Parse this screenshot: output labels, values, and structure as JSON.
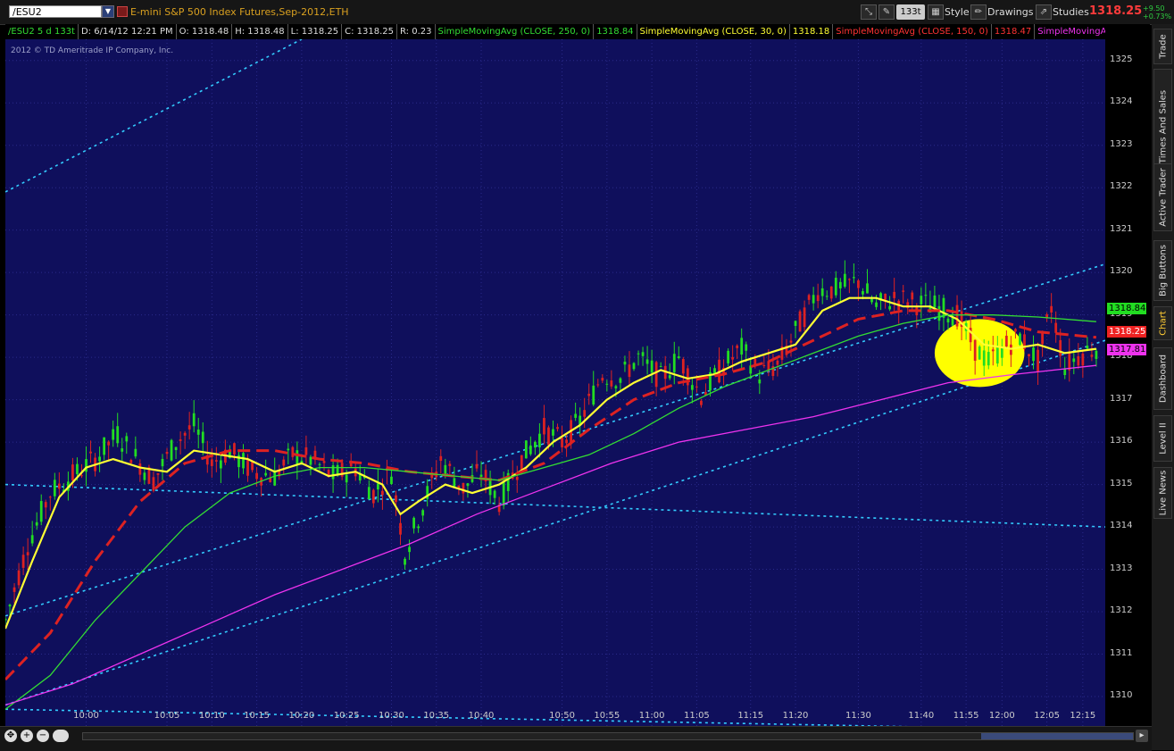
{
  "toolbar": {
    "symbol": "/ESU2",
    "description": "E-mini S&P 500 Index Futures,Sep-2012,ETH",
    "aggregation": "133t",
    "style_label": "Style",
    "drawings_label": "Drawings",
    "studies_label": "Studies",
    "last_price": "1318.25",
    "change_abs": "+9.50",
    "change_pct": "+0.73%"
  },
  "info": {
    "symbol_period": "/ESU2 5 d 133t",
    "datetime": "D: 6/14/12 12:21 PM",
    "open": "O: 1318.48",
    "high": "H: 1318.48",
    "low": "L: 1318.25",
    "close": "C: 1318.25",
    "range": "R: 0.23",
    "study1_label": "SimpleMovingAvg (CLOSE, 250, 0)",
    "study1_value": "1318.84",
    "study2_label": "SimpleMovingAvg (CLOSE, 30, 0)",
    "study2_value": "1318.18",
    "study3_label": "SimpleMovingAvg (CLOSE, 150, 0)",
    "study3_value": "1318.47",
    "study4_label": "SimpleMovingAvg (..."
  },
  "copyright": "2012 © TD Ameritrade IP Company, Inc.",
  "badges": {
    "sma250": "1318.84",
    "last": "1318.25",
    "sma150b": "1317.81"
  },
  "sidebar": {
    "tabs": [
      "Trade",
      "Times And Sales",
      "Active Trader",
      "Big Buttons",
      "Chart",
      "Dashboard",
      "Level II",
      "Live News"
    ]
  },
  "colors": {
    "background": "#0f0f5c",
    "up_bar": "#22dd22",
    "down_bar": "#dd2222",
    "sma30": "#ffff33",
    "sma150": "#dd2222",
    "sma250": "#33dd33",
    "sma_magenta": "#ee33ee",
    "trendline": "#33ccff",
    "highlight": "#ffff00"
  },
  "chart_data": {
    "type": "line",
    "title": "",
    "xlabel": "",
    "ylabel": "",
    "ylim": [
      1309.2,
      1325.5
    ],
    "xlim": [
      0,
      245
    ],
    "grid": true,
    "x_ticks": [
      {
        "i": 18,
        "label": "10:00"
      },
      {
        "i": 36,
        "label": "10:05"
      },
      {
        "i": 46,
        "label": "10:10"
      },
      {
        "i": 56,
        "label": "10:15"
      },
      {
        "i": 66,
        "label": "10:20"
      },
      {
        "i": 76,
        "label": "10:25"
      },
      {
        "i": 86,
        "label": "10:30"
      },
      {
        "i": 96,
        "label": "10:35"
      },
      {
        "i": 106,
        "label": "10:40"
      },
      {
        "i": 124,
        "label": "10:50"
      },
      {
        "i": 134,
        "label": "10:55"
      },
      {
        "i": 144,
        "label": "11:00"
      },
      {
        "i": 154,
        "label": "11:05"
      },
      {
        "i": 166,
        "label": "11:15"
      },
      {
        "i": 176,
        "label": "11:20"
      },
      {
        "i": 190,
        "label": "11:30"
      },
      {
        "i": 204,
        "label": "11:40"
      },
      {
        "i": 214,
        "label": "11:55"
      },
      {
        "i": 222,
        "label": "12:00"
      },
      {
        "i": 232,
        "label": "12:05"
      },
      {
        "i": 240,
        "label": "12:15"
      }
    ],
    "y_ticks": [
      1310,
      1311,
      1312,
      1313,
      1314,
      1315,
      1316,
      1317,
      1318,
      1319,
      1320,
      1321,
      1322,
      1323,
      1324,
      1325
    ],
    "price_path": [
      [
        0,
        1311.8
      ],
      [
        5,
        1313.6
      ],
      [
        10,
        1314.8
      ],
      [
        15,
        1315.2
      ],
      [
        20,
        1315.6
      ],
      [
        25,
        1316.2
      ],
      [
        30,
        1315.5
      ],
      [
        33,
        1315.1
      ],
      [
        38,
        1316.0
      ],
      [
        42,
        1316.4
      ],
      [
        46,
        1315.5
      ],
      [
        50,
        1315.8
      ],
      [
        55,
        1315.3
      ],
      [
        60,
        1315.2
      ],
      [
        64,
        1315.7
      ],
      [
        68,
        1315.6
      ],
      [
        73,
        1315.2
      ],
      [
        78,
        1315.4
      ],
      [
        82,
        1314.8
      ],
      [
        86,
        1315.3
      ],
      [
        89,
        1313.4
      ],
      [
        93,
        1314.5
      ],
      [
        97,
        1315.6
      ],
      [
        102,
        1314.9
      ],
      [
        106,
        1315.3
      ],
      [
        110,
        1314.6
      ],
      [
        115,
        1315.6
      ],
      [
        120,
        1316.3
      ],
      [
        124,
        1316.0
      ],
      [
        128,
        1316.5
      ],
      [
        133,
        1317.6
      ],
      [
        137,
        1317.5
      ],
      [
        141,
        1318.0
      ],
      [
        146,
        1317.5
      ],
      [
        150,
        1318.0
      ],
      [
        155,
        1317.1
      ],
      [
        160,
        1317.8
      ],
      [
        164,
        1318.2
      ],
      [
        168,
        1317.6
      ],
      [
        172,
        1317.8
      ],
      [
        176,
        1318.6
      ],
      [
        181,
        1319.6
      ],
      [
        185,
        1319.6
      ],
      [
        190,
        1319.8
      ],
      [
        194,
        1319.2
      ],
      [
        198,
        1319.4
      ],
      [
        202,
        1319.3
      ],
      [
        207,
        1319.2
      ],
      [
        212,
        1319.0
      ],
      [
        216,
        1318.2
      ],
      [
        219,
        1317.9
      ],
      [
        222,
        1318.2
      ],
      [
        226,
        1318.5
      ],
      [
        230,
        1317.9
      ],
      [
        233,
        1319.2
      ],
      [
        236,
        1317.8
      ],
      [
        240,
        1318.1
      ],
      [
        243,
        1318.25
      ]
    ],
    "series": [
      {
        "label": "SimpleMovingAvg (CLOSE, 30, 0)",
        "color": "#ffff33",
        "style": "solid",
        "points": [
          [
            0,
            1311.6
          ],
          [
            6,
            1313.2
          ],
          [
            12,
            1314.7
          ],
          [
            18,
            1315.4
          ],
          [
            24,
            1315.6
          ],
          [
            30,
            1315.4
          ],
          [
            36,
            1315.3
          ],
          [
            42,
            1315.8
          ],
          [
            48,
            1315.7
          ],
          [
            54,
            1315.6
          ],
          [
            60,
            1315.3
          ],
          [
            66,
            1315.5
          ],
          [
            72,
            1315.2
          ],
          [
            78,
            1315.3
          ],
          [
            84,
            1315.0
          ],
          [
            88,
            1314.3
          ],
          [
            92,
            1314.6
          ],
          [
            98,
            1315.0
          ],
          [
            104,
            1314.8
          ],
          [
            110,
            1315.0
          ],
          [
            116,
            1315.4
          ],
          [
            122,
            1316.0
          ],
          [
            128,
            1316.4
          ],
          [
            134,
            1317.0
          ],
          [
            140,
            1317.4
          ],
          [
            146,
            1317.7
          ],
          [
            152,
            1317.5
          ],
          [
            158,
            1317.6
          ],
          [
            164,
            1317.9
          ],
          [
            170,
            1318.1
          ],
          [
            176,
            1318.3
          ],
          [
            182,
            1319.1
          ],
          [
            188,
            1319.4
          ],
          [
            194,
            1319.4
          ],
          [
            200,
            1319.2
          ],
          [
            206,
            1319.2
          ],
          [
            212,
            1318.9
          ],
          [
            218,
            1318.3
          ],
          [
            224,
            1318.2
          ],
          [
            230,
            1318.3
          ],
          [
            236,
            1318.1
          ],
          [
            243,
            1318.2
          ]
        ]
      },
      {
        "label": "SimpleMovingAvg (CLOSE, 150, 0)",
        "color": "#dd2222",
        "style": "dashed",
        "points": [
          [
            0,
            1310.4
          ],
          [
            10,
            1311.5
          ],
          [
            20,
            1313.2
          ],
          [
            30,
            1314.6
          ],
          [
            40,
            1315.5
          ],
          [
            50,
            1315.8
          ],
          [
            60,
            1315.8
          ],
          [
            70,
            1315.6
          ],
          [
            80,
            1315.5
          ],
          [
            90,
            1315.3
          ],
          [
            100,
            1315.2
          ],
          [
            110,
            1315.1
          ],
          [
            120,
            1315.5
          ],
          [
            130,
            1316.3
          ],
          [
            140,
            1317.0
          ],
          [
            150,
            1317.4
          ],
          [
            160,
            1317.6
          ],
          [
            170,
            1317.9
          ],
          [
            180,
            1318.4
          ],
          [
            190,
            1318.9
          ],
          [
            200,
            1319.1
          ],
          [
            210,
            1319.1
          ],
          [
            220,
            1318.9
          ],
          [
            230,
            1318.6
          ],
          [
            243,
            1318.47
          ]
        ]
      },
      {
        "label": "SimpleMovingAvg (CLOSE, 250, 0)",
        "color": "#33dd33",
        "style": "solid",
        "points": [
          [
            0,
            1309.7
          ],
          [
            10,
            1310.5
          ],
          [
            20,
            1311.8
          ],
          [
            30,
            1312.9
          ],
          [
            40,
            1314.0
          ],
          [
            50,
            1314.8
          ],
          [
            60,
            1315.2
          ],
          [
            70,
            1315.4
          ],
          [
            80,
            1315.4
          ],
          [
            90,
            1315.3
          ],
          [
            100,
            1315.2
          ],
          [
            110,
            1315.1
          ],
          [
            120,
            1315.4
          ],
          [
            130,
            1315.7
          ],
          [
            140,
            1316.2
          ],
          [
            150,
            1316.8
          ],
          [
            160,
            1317.3
          ],
          [
            170,
            1317.7
          ],
          [
            180,
            1318.1
          ],
          [
            190,
            1318.5
          ],
          [
            200,
            1318.8
          ],
          [
            210,
            1319.0
          ],
          [
            220,
            1319.0
          ],
          [
            230,
            1318.95
          ],
          [
            243,
            1318.84
          ]
        ]
      },
      {
        "label": "SimpleMovingAvg (...",
        "color": "#ee33ee",
        "style": "solid",
        "points": [
          [
            0,
            1309.8
          ],
          [
            15,
            1310.3
          ],
          [
            30,
            1311.0
          ],
          [
            45,
            1311.7
          ],
          [
            60,
            1312.4
          ],
          [
            75,
            1313.0
          ],
          [
            90,
            1313.6
          ],
          [
            105,
            1314.3
          ],
          [
            120,
            1314.9
          ],
          [
            135,
            1315.5
          ],
          [
            150,
            1316.0
          ],
          [
            165,
            1316.3
          ],
          [
            180,
            1316.6
          ],
          [
            195,
            1317.0
          ],
          [
            210,
            1317.4
          ],
          [
            225,
            1317.6
          ],
          [
            243,
            1317.81
          ]
        ]
      }
    ],
    "trendlines": [
      {
        "from": [
          0,
          1321.9
        ],
        "to": [
          66,
          1325.5
        ]
      },
      {
        "from": [
          0,
          1315.0
        ],
        "to": [
          245,
          1314.0
        ]
      },
      {
        "from": [
          0,
          1309.7
        ],
        "to": [
          245,
          1309.2
        ]
      },
      {
        "from": [
          0,
          1311.9
        ],
        "to": [
          245,
          1320.2
        ]
      },
      {
        "from": [
          0,
          1309.8
        ],
        "to": [
          245,
          1318.4
        ]
      }
    ],
    "highlight_ellipse": {
      "center": [
        217,
        1318.1
      ],
      "rx_bars": 10,
      "ry_price": 0.8
    }
  }
}
